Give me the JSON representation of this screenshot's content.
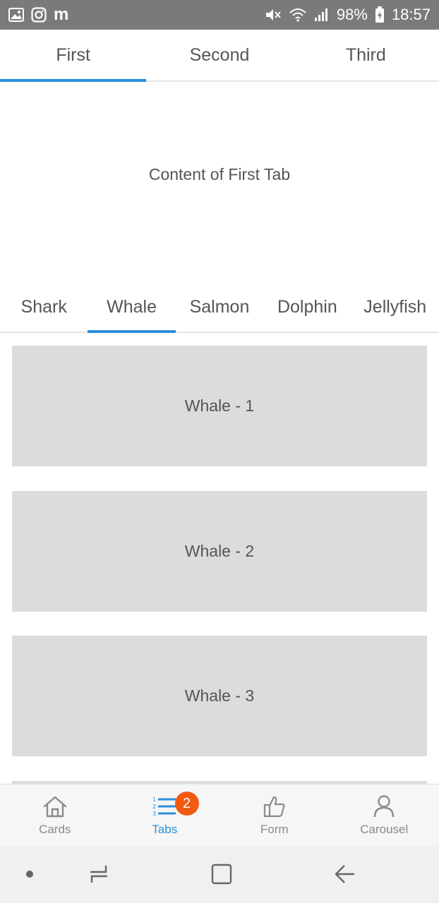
{
  "status_bar": {
    "battery": "98%",
    "time": "18:57",
    "app_letter": "m",
    "icons": [
      "gallery-icon",
      "instagram-icon",
      "m-icon",
      "mute-icon",
      "wifi-icon",
      "signal-icon",
      "battery-charging-icon"
    ]
  },
  "top_tabs": [
    {
      "label": "First",
      "active": true
    },
    {
      "label": "Second",
      "active": false
    },
    {
      "label": "Third",
      "active": false
    }
  ],
  "tab_content": {
    "text": "Content of First Tab"
  },
  "animal_tabs": [
    {
      "label": "Shark",
      "active": false
    },
    {
      "label": "Whale",
      "active": true
    },
    {
      "label": "Salmon",
      "active": false
    },
    {
      "label": "Dolphin",
      "active": false
    },
    {
      "label": "Jellyfish",
      "active": false
    }
  ],
  "cards": [
    {
      "label": "Whale - 1"
    },
    {
      "label": "Whale - 2"
    },
    {
      "label": "Whale - 3"
    },
    {
      "label": ""
    }
  ],
  "bottom_nav": [
    {
      "label": "Cards",
      "icon": "home-icon",
      "active": false
    },
    {
      "label": "Tabs",
      "icon": "list-icon",
      "active": true,
      "badge": "2"
    },
    {
      "label": "Form",
      "icon": "thumbs-up-icon",
      "active": false
    },
    {
      "label": "Carousel",
      "icon": "user-icon",
      "active": false
    }
  ],
  "colors": {
    "accent": "#2b8fdc",
    "badge": "#f25a12",
    "card_bg": "#dcdcdc",
    "status_bar_bg": "#7a7a7a"
  }
}
